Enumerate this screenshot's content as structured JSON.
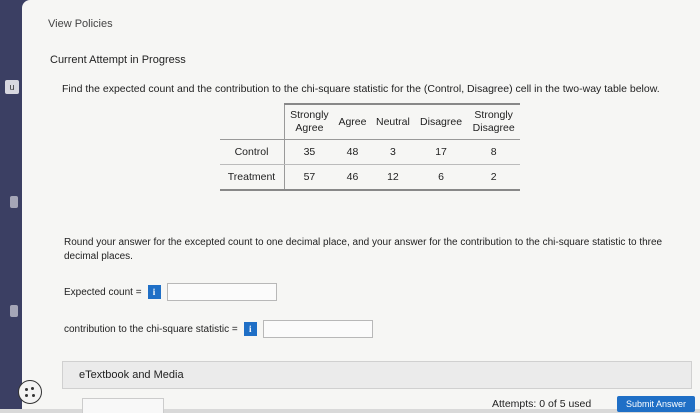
{
  "header": {
    "view_policies": "View Policies",
    "attempt_title": "Current Attempt in Progress"
  },
  "question": {
    "text": "Find the expected count and the contribution to the chi-square statistic for the (Control, Disagree) cell in the two-way table below."
  },
  "table": {
    "columns": [
      {
        "line1": "Strongly",
        "line2": "Agree"
      },
      {
        "line1": "Agree",
        "line2": ""
      },
      {
        "line1": "Neutral",
        "line2": ""
      },
      {
        "line1": "Disagree",
        "line2": ""
      },
      {
        "line1": "Strongly",
        "line2": "Disagree"
      }
    ],
    "rows": [
      {
        "label": "Control",
        "values": [
          "35",
          "48",
          "3",
          "17",
          "8"
        ]
      },
      {
        "label": "Treatment",
        "values": [
          "57",
          "46",
          "12",
          "6",
          "2"
        ]
      }
    ]
  },
  "instructions": "Round your answer for the excepted count to one decimal place, and your answer for the contribution to the chi-square statistic to three decimal places.",
  "answers": {
    "expected_label": "Expected count =",
    "expected_value": "",
    "contribution_label": "contribution to the chi-square statistic =",
    "contribution_value": "",
    "info_glyph": "i"
  },
  "footer": {
    "etextbook": "eTextbook and Media",
    "attempts": "Attempts: 0 of 5 used",
    "submit": "Submit Answer"
  },
  "rail": {
    "badge": "u"
  },
  "colors": {
    "accent": "#1f6fc6",
    "rail": "#3b3f63"
  }
}
